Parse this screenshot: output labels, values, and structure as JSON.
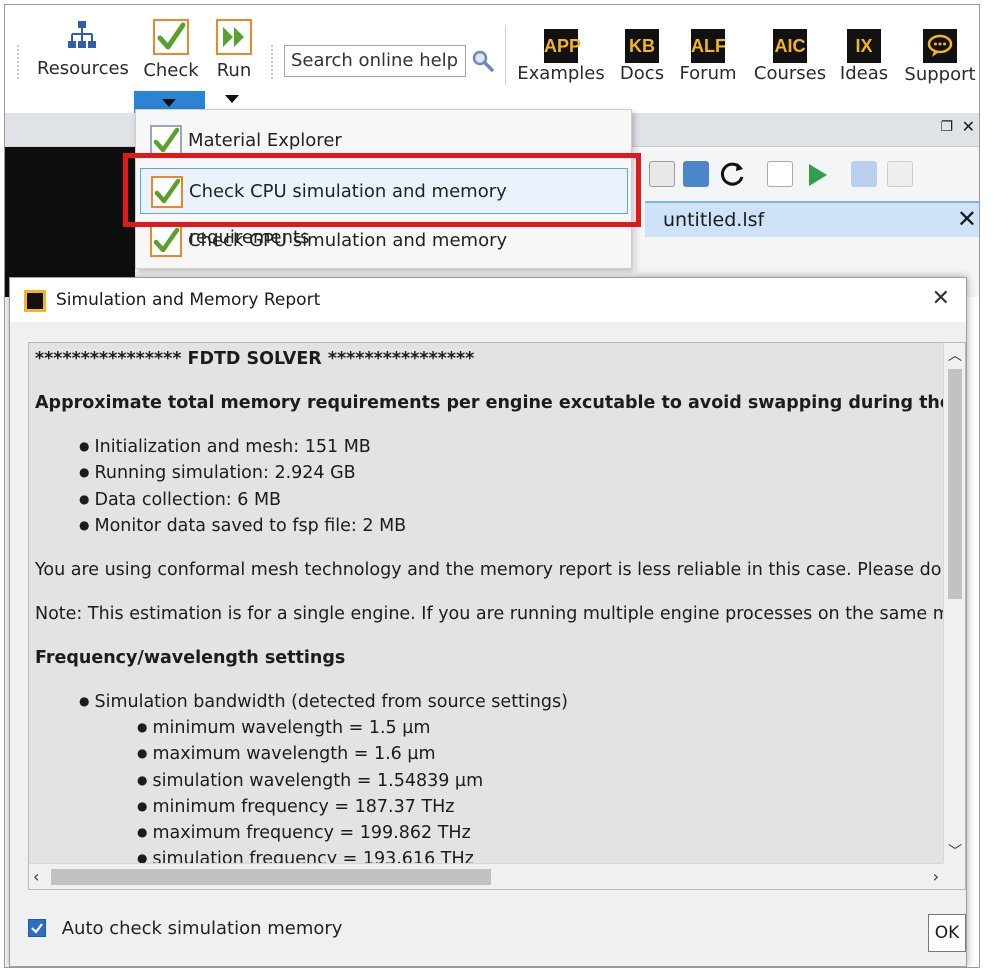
{
  "ribbon": {
    "resources_label": "Resources",
    "check_label": "Check",
    "run_label": "Run",
    "search_placeholder": "Search online help",
    "links": [
      {
        "badge": "APP",
        "label": "Examples"
      },
      {
        "badge": "KB",
        "label": "Docs"
      },
      {
        "badge": "ALF",
        "label": "Forum"
      },
      {
        "badge": "AIC",
        "label": "Courses"
      },
      {
        "badge": "IX",
        "label": "Ideas"
      },
      {
        "badge": "",
        "label": "Support"
      }
    ]
  },
  "background": {
    "script_tab": "untitled.lsf"
  },
  "check_menu": {
    "items": [
      {
        "label": "Material Explorer"
      },
      {
        "label": "Check CPU simulation and memory requirements"
      },
      {
        "label": "Check GPU simulation and memory requirements"
      }
    ]
  },
  "dialog": {
    "title": "Simulation and Memory Report",
    "report": {
      "header": "**************** FDTD SOLVER ****************",
      "memory_heading": "Approximate total memory requirements per engine excutable to avoid swapping during the simulati",
      "memory_items": [
        "Initialization and mesh: 151 MB",
        "Running simulation: 2.924 GB",
        "Data collection: 6 MB",
        "Monitor data saved to fsp file: 2 MB"
      ],
      "conformal_note": "You are using conformal mesh technology and the memory report is less reliable in this case. Please do som",
      "engine_note": "Note: This estimation is for a single engine. If you are running multiple engine processes on the same mach",
      "freq_heading": "Frequency/wavelength settings",
      "bandwidth_item": "Simulation bandwidth (detected from source settings)",
      "bandwidth_subitems": [
        "minimum wavelength = 1.5 µm",
        "maximum wavelength = 1.6 µm",
        "simulation wavelength = 1.54839 µm",
        "minimum frequency = 187.37 THz",
        "maximum frequency = 199.862 THz",
        "simulation frequency = 193.616 THz"
      ]
    },
    "auto_check_label": "Auto check simulation memory",
    "auto_check_checked": true,
    "ok_label": "OK"
  },
  "colors": {
    "accent_orange": "#e9892e",
    "check_green": "#5aa02c",
    "highlight_red": "#e0191d",
    "selection_blue": "#2b83d4"
  }
}
